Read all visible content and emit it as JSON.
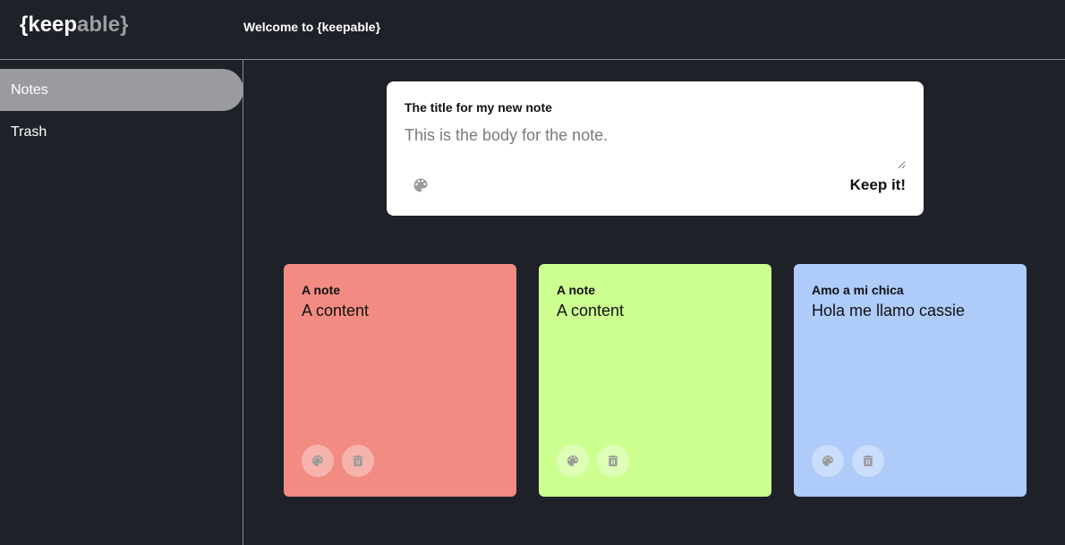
{
  "header": {
    "logo_prefix": "{keep",
    "logo_suffix": "able}",
    "welcome": "Welcome to {keepable}"
  },
  "sidebar": {
    "items": [
      {
        "label": "Notes",
        "active": true
      },
      {
        "label": "Trash",
        "active": false
      }
    ]
  },
  "composer": {
    "title_placeholder": "The title for my new note",
    "body_placeholder": "This is the body for the note.",
    "palette_icon": "palette-icon",
    "submit_label": "Keep it!"
  },
  "notes": [
    {
      "title": "A note",
      "content": "A content",
      "color": "#f28b82"
    },
    {
      "title": "A note",
      "content": "A content",
      "color": "#ccff90"
    },
    {
      "title": "Amo a mi chica",
      "content": "Hola me llamo cassie",
      "color": "#aecbfa"
    }
  ],
  "icons": {
    "palette": "palette-icon",
    "trash": "trash-icon"
  },
  "colors": {
    "background": "#1f2129",
    "active_nav": "#9a9b9f",
    "icon_gray": "#9a9a9a"
  }
}
